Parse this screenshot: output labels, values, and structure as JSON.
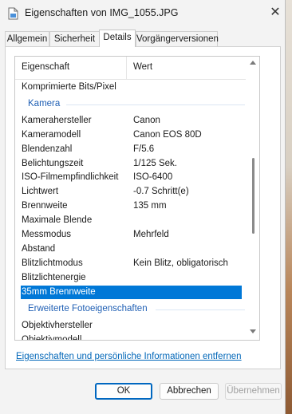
{
  "window": {
    "title": "Eigenschaften von IMG_1055.JPG",
    "close_symbol": "✕"
  },
  "tabs": [
    {
      "label": "Allgemein"
    },
    {
      "label": "Sicherheit"
    },
    {
      "label": "Details"
    },
    {
      "label": "Vorgängerversionen"
    }
  ],
  "active_tab": "Details",
  "list": {
    "header": {
      "property": "Eigenschaft",
      "value": "Wert"
    },
    "rows_top": [
      {
        "property": "Komprimierte Bits/Pixel",
        "value": ""
      }
    ],
    "group_camera": "Kamera",
    "camera_rows": [
      {
        "property": "Kamerahersteller",
        "value": "Canon"
      },
      {
        "property": "Kameramodell",
        "value": "Canon EOS 80D"
      },
      {
        "property": "Blendenzahl",
        "value": "F/5.6"
      },
      {
        "property": "Belichtungszeit",
        "value": "1/125 Sek."
      },
      {
        "property": "ISO-Filmempfindlichkeit",
        "value": "ISO-6400"
      },
      {
        "property": "Lichtwert",
        "value": "-0.7 Schritt(e)"
      },
      {
        "property": "Brennweite",
        "value": "135 mm"
      },
      {
        "property": "Maximale Blende",
        "value": ""
      },
      {
        "property": "Messmodus",
        "value": "Mehrfeld"
      },
      {
        "property": "Abstand",
        "value": ""
      },
      {
        "property": "Blitzlichtmodus",
        "value": "Kein Blitz, obligatorisch"
      },
      {
        "property": "Blitzlichtenergie",
        "value": ""
      },
      {
        "property": "35mm Brennweite",
        "value": ""
      }
    ],
    "selected_property": "35mm Brennweite",
    "group_advanced": "Erweiterte Fotoeigenschaften",
    "advanced_rows": [
      {
        "property": "Objektivhersteller",
        "value": ""
      },
      {
        "property": "Objektivmodell",
        "value": ""
      }
    ]
  },
  "remove_link": "Eigenschaften und persönliche Informationen entfernen",
  "buttons": {
    "ok": "OK",
    "cancel": "Abbrechen",
    "apply": "Übernehmen",
    "apply_enabled": false
  },
  "colors": {
    "selection": "#0078d7",
    "group_header": "#1f5fb4",
    "link": "#0066b8",
    "ok_border": "#0067c0"
  }
}
